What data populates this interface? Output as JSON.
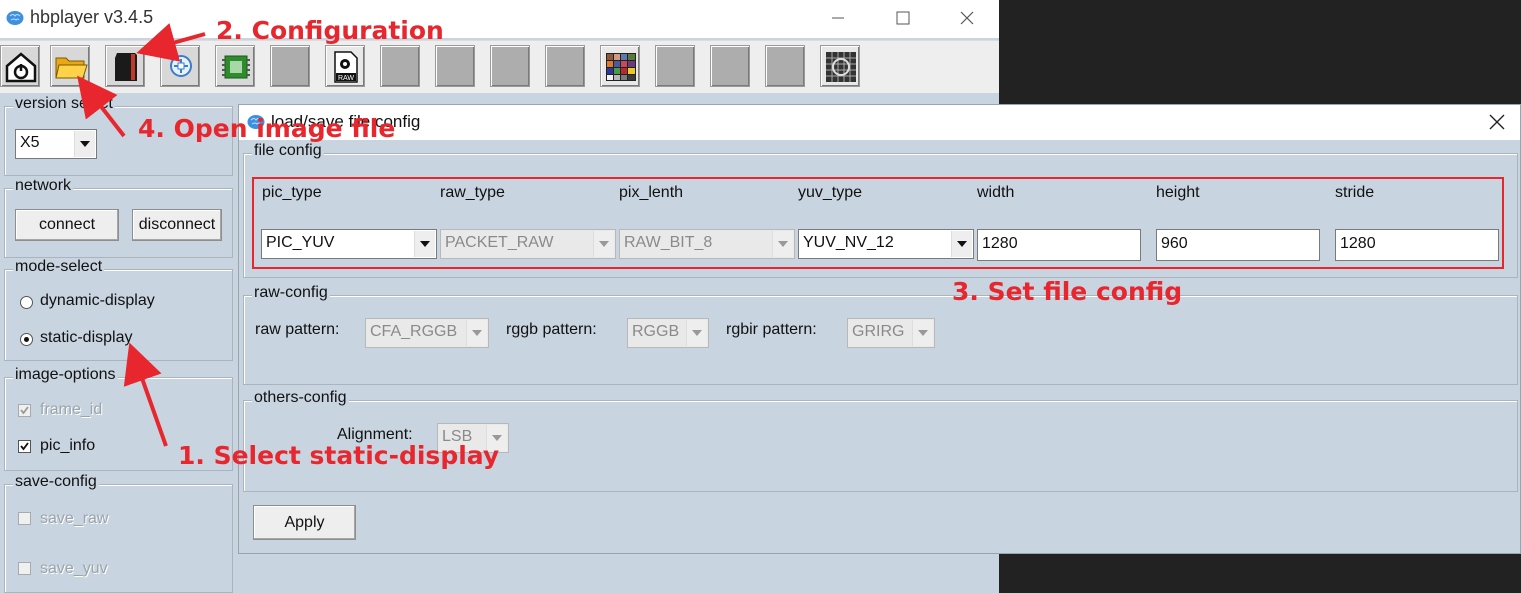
{
  "app": {
    "title": "hbplayer v3.4.5"
  },
  "window_controls": {
    "minimize": "minimize-icon",
    "maximize": "maximize-icon",
    "close": "close-icon"
  },
  "toolbar": {
    "buttons": [
      {
        "name": "home-icon"
      },
      {
        "name": "folder-icon"
      },
      {
        "name": "sd-card-icon"
      },
      {
        "name": "zoom-icon"
      },
      {
        "name": "chip-icon"
      },
      {
        "name": "blank-icon"
      },
      {
        "name": "raw-file-icon",
        "label": "RAW"
      },
      {
        "name": "blank-icon"
      },
      {
        "name": "blank-icon"
      },
      {
        "name": "blank-icon"
      },
      {
        "name": "color-checker-icon"
      },
      {
        "name": "blank-icon"
      },
      {
        "name": "blank-icon"
      },
      {
        "name": "blank-icon"
      },
      {
        "name": "sensor-grid-icon"
      }
    ]
  },
  "left": {
    "version_select": {
      "label": "version select",
      "value": "X5"
    },
    "network": {
      "label": "network",
      "connect": "connect",
      "disconnect": "disconnect"
    },
    "mode_select": {
      "label": "mode-select",
      "dynamic": "dynamic-display",
      "static": "static-display",
      "selected": "static-display"
    },
    "image_options": {
      "label": "image-options",
      "frame_id": "frame_id",
      "pic_info": "pic_info"
    },
    "save_config": {
      "label": "save-config",
      "save_raw": "save_raw",
      "save_yuv": "save_yuv"
    }
  },
  "dialog": {
    "title": "load/save file config",
    "file_config": {
      "label": "file config",
      "headers": {
        "pic_type": "pic_type",
        "raw_type": "raw_type",
        "pix_lenth": "pix_lenth",
        "yuv_type": "yuv_type",
        "width": "width",
        "height": "height",
        "stride": "stride"
      },
      "values": {
        "pic_type": "PIC_YUV",
        "raw_type": "PACKET_RAW",
        "pix_lenth": "RAW_BIT_8",
        "yuv_type": "YUV_NV_12",
        "width": "1280",
        "height": "960",
        "stride": "1280"
      }
    },
    "raw_config": {
      "label": "raw-config",
      "raw_pattern_label": "raw pattern:",
      "raw_pattern": "CFA_RGGB",
      "rggb_pattern_label": "rggb pattern:",
      "rggb_pattern": "RGGB",
      "rgbir_pattern_label": "rgbir pattern:",
      "rgbir_pattern": "GRIRG"
    },
    "others_config": {
      "label": "others-config",
      "alignment_label": "Alignment:",
      "alignment": "LSB"
    },
    "apply": "Apply"
  },
  "annotations": {
    "step1": "1. Select static-display",
    "step2": "2. Configuration",
    "step3": "3. Set file config",
    "step4": "4. Open image file"
  },
  "colors": {
    "annotation_red": "#e8262d",
    "panel_bg": "#c8d4df"
  }
}
